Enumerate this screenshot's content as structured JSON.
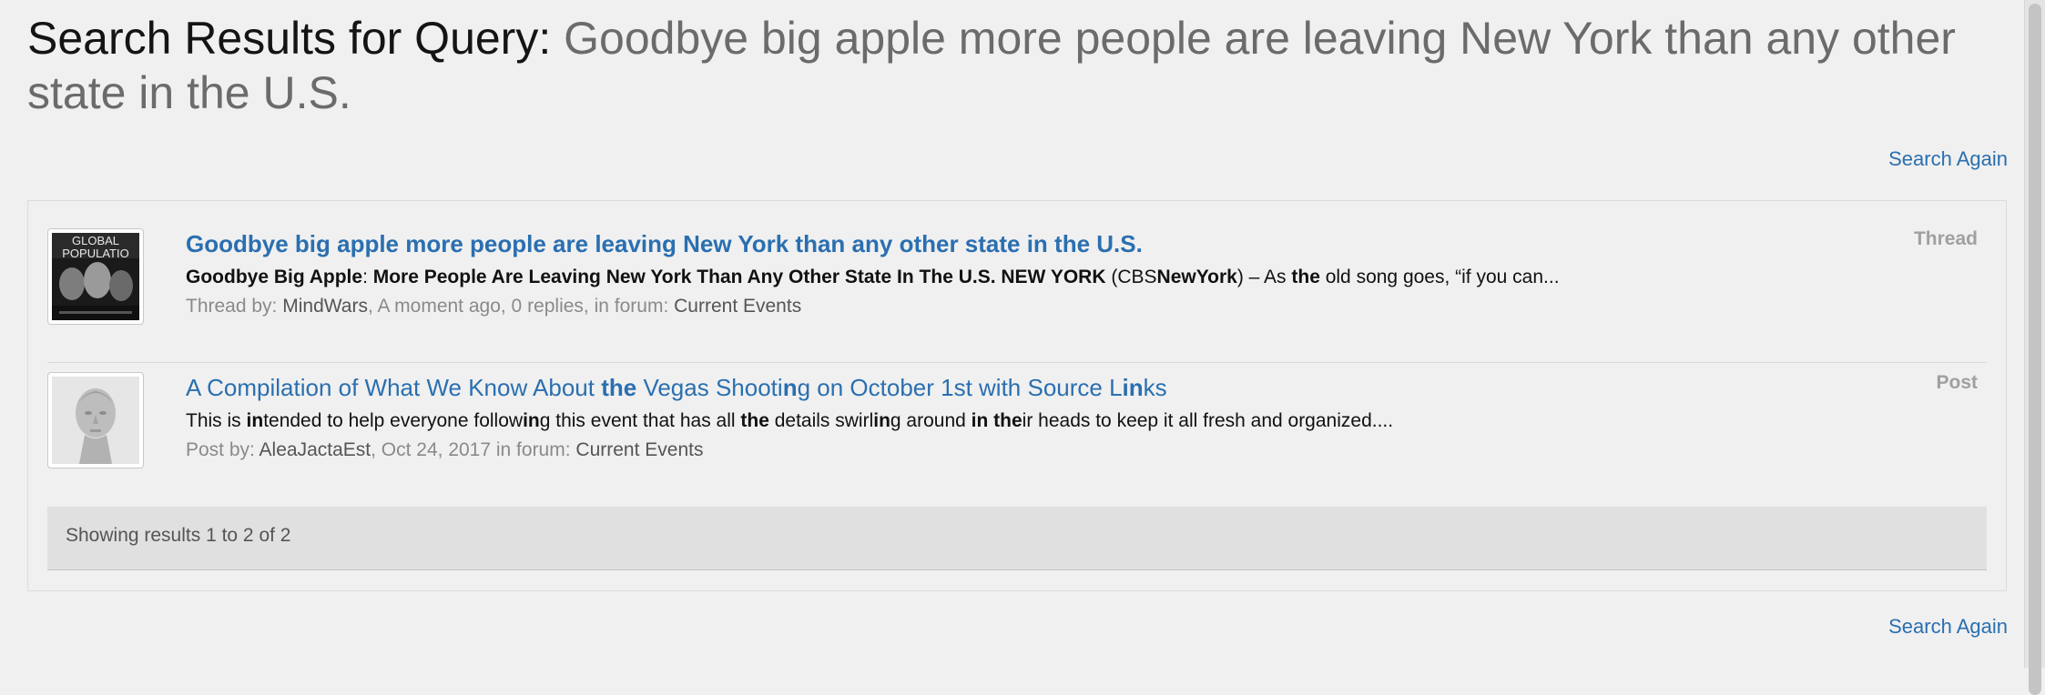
{
  "header": {
    "label": "Search Results for Query:",
    "query": "Goodbye big apple more people are leaving New York than any other state in the U.S."
  },
  "search_again_label": "Search Again",
  "results": [
    {
      "type": "Thread",
      "title": "Goodbye big apple more people are leaving New York than any other state in the U.S.",
      "snippet": [
        {
          "t": "Goodbye Big Apple",
          "b": true
        },
        {
          "t": ": ",
          "b": false
        },
        {
          "t": "More People Are Leaving New York Than Any Other State In The U.S. NEW YORK",
          "b": true
        },
        {
          "t": " (CBS",
          "b": false
        },
        {
          "t": "NewYork",
          "b": true
        },
        {
          "t": ") – As ",
          "b": false
        },
        {
          "t": "the",
          "b": true
        },
        {
          "t": " old song goes, “if you can...",
          "b": false
        }
      ],
      "meta_prefix": "Thread by: ",
      "author": "MindWars",
      "meta_mid": ", A moment ago, 0 replies, in forum: ",
      "forum": "Current Events",
      "avatar_text": [
        "GLOBAL",
        "POPULATIO"
      ]
    },
    {
      "type": "Post",
      "title": [
        {
          "t": "A Compilation of What We Know About ",
          "b": false
        },
        {
          "t": "the",
          "b": true
        },
        {
          "t": " Vegas Shooti",
          "b": false
        },
        {
          "t": "n",
          "b": true
        },
        {
          "t": "g on October 1st with Source L",
          "b": false
        },
        {
          "t": "in",
          "b": true
        },
        {
          "t": "ks",
          "b": false
        }
      ],
      "snippet": [
        {
          "t": "This is ",
          "b": false
        },
        {
          "t": "in",
          "b": true
        },
        {
          "t": "tended to help everyone follow",
          "b": false
        },
        {
          "t": "in",
          "b": true
        },
        {
          "t": "g this event that has all ",
          "b": false
        },
        {
          "t": "the",
          "b": true
        },
        {
          "t": " details swirl",
          "b": false
        },
        {
          "t": "in",
          "b": true
        },
        {
          "t": "g around ",
          "b": false
        },
        {
          "t": "in the",
          "b": true
        },
        {
          "t": "ir heads to keep it all fresh and organized....",
          "b": false
        }
      ],
      "meta_prefix": "Post by: ",
      "author": "AleaJactaEst",
      "meta_mid": ", Oct 24, 2017 in forum: ",
      "forum": "Current Events"
    }
  ],
  "footer": {
    "showing": "Showing results 1 to 2 of 2"
  }
}
